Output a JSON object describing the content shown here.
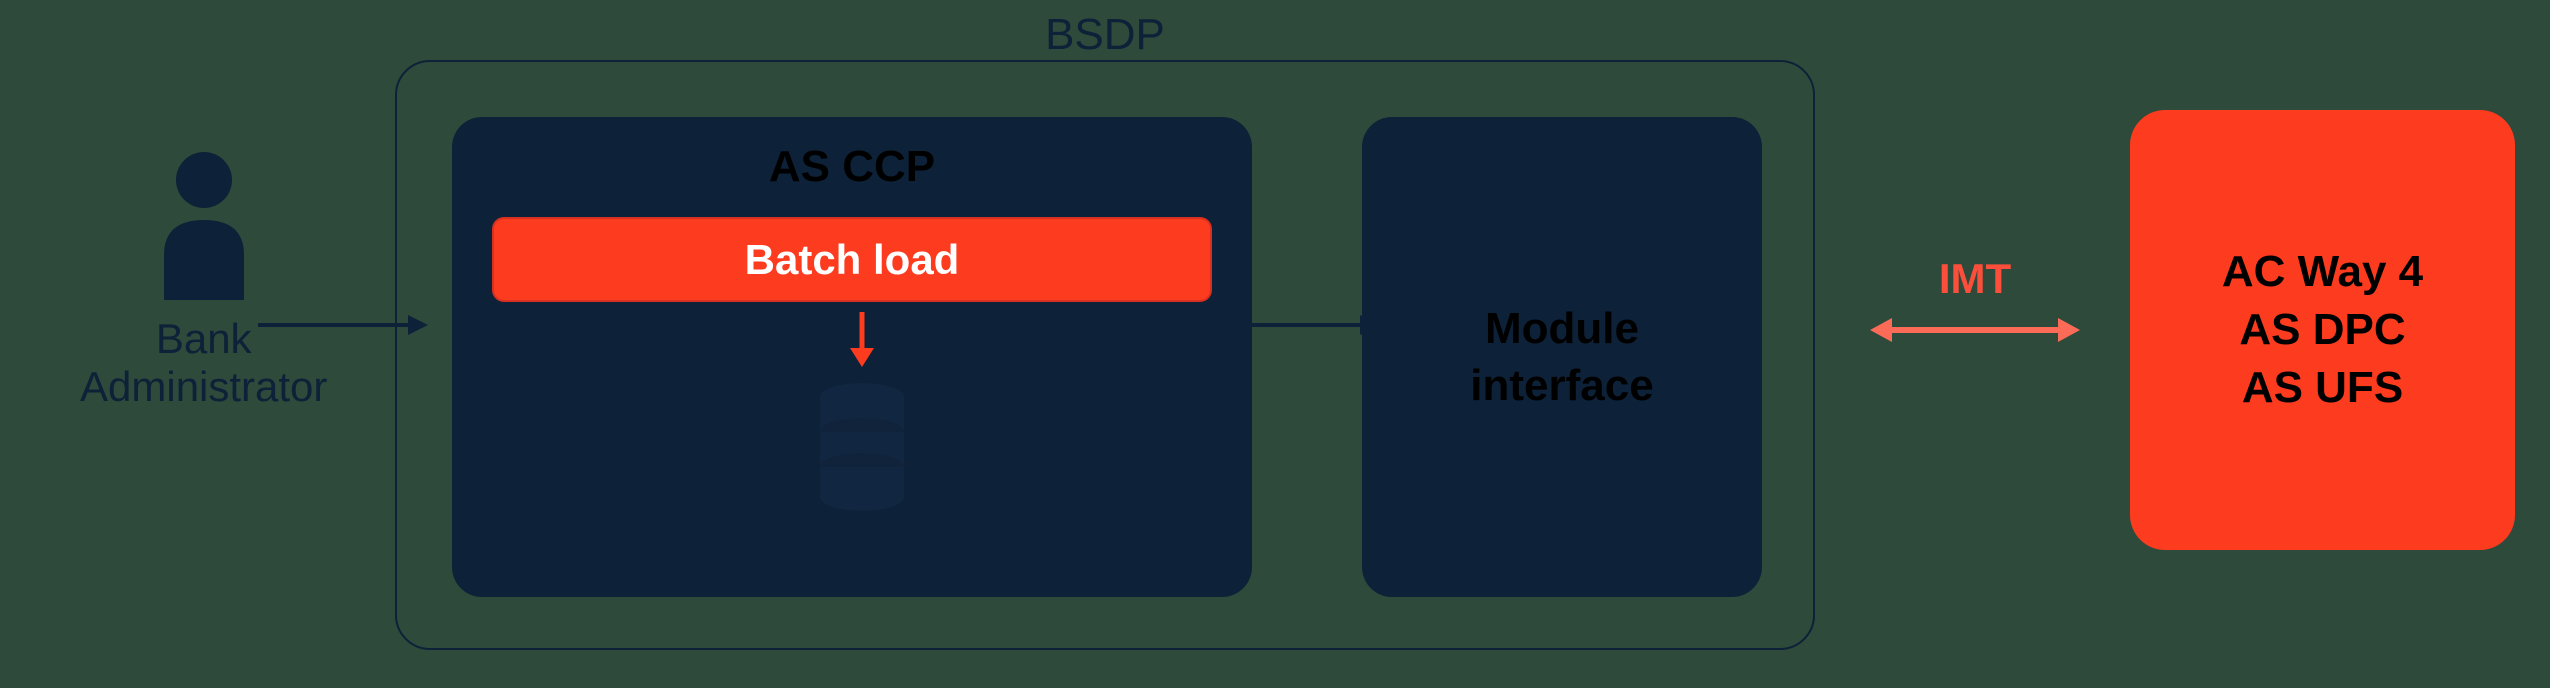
{
  "actor": {
    "label": "Bank\nAdministrator"
  },
  "bsdp": {
    "title": "BSDP",
    "as_ccp": {
      "title": "AS CCP",
      "batch_load": "Batch load"
    },
    "module": {
      "title": "Module\ninterface"
    }
  },
  "imt": {
    "label": "IMT"
  },
  "external": {
    "line1": "AC Way 4",
    "line2": "AS DPC",
    "line3": "AS UFS"
  },
  "colors": {
    "accent": "#fc3b1f",
    "dark_box": "#0d2138",
    "bg": "#2d4a3a",
    "accent_light": "#fc6a58"
  }
}
